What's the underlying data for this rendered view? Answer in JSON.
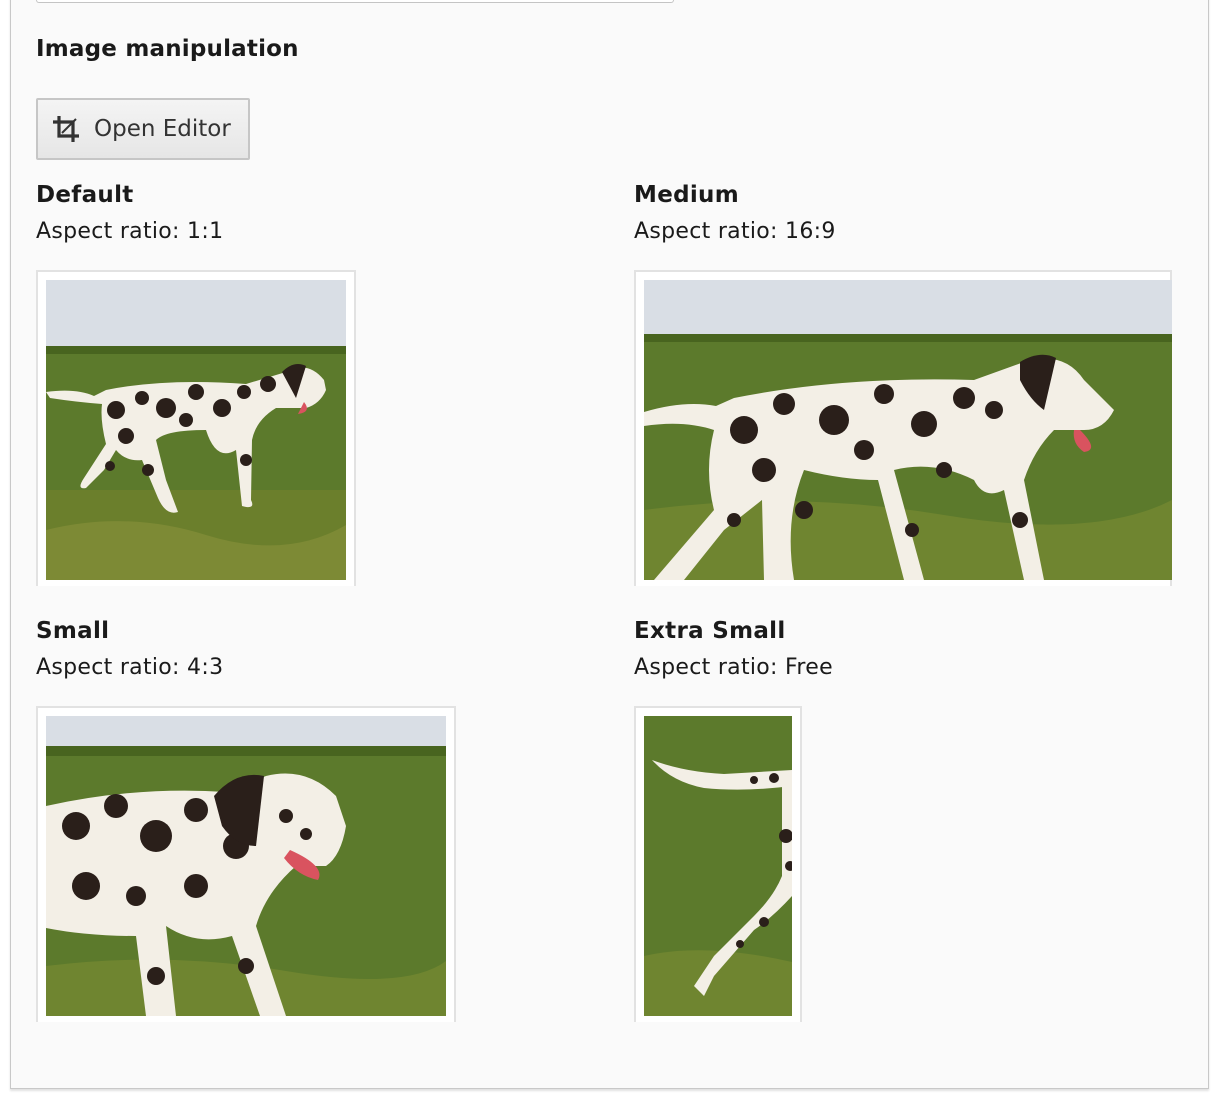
{
  "section": {
    "heading": "Image manipulation",
    "open_editor_label": "Open Editor",
    "open_editor_icon": "crop-icon"
  },
  "crops": [
    {
      "title": "Default",
      "ratio_text": "Aspect ratio: 1:1"
    },
    {
      "title": "Medium",
      "ratio_text": "Aspect ratio: 16:9"
    },
    {
      "title": "Small",
      "ratio_text": "Aspect ratio: 4:3"
    },
    {
      "title": "Extra Small",
      "ratio_text": "Aspect ratio: Free"
    }
  ],
  "colors": {
    "sky": "#d9dee5",
    "grass": "#5c7a2c",
    "grass_dark": "#3f5a1b",
    "dog_white": "#f3efe6",
    "dog_spot": "#2a1f1a",
    "tongue": "#d9535f"
  }
}
